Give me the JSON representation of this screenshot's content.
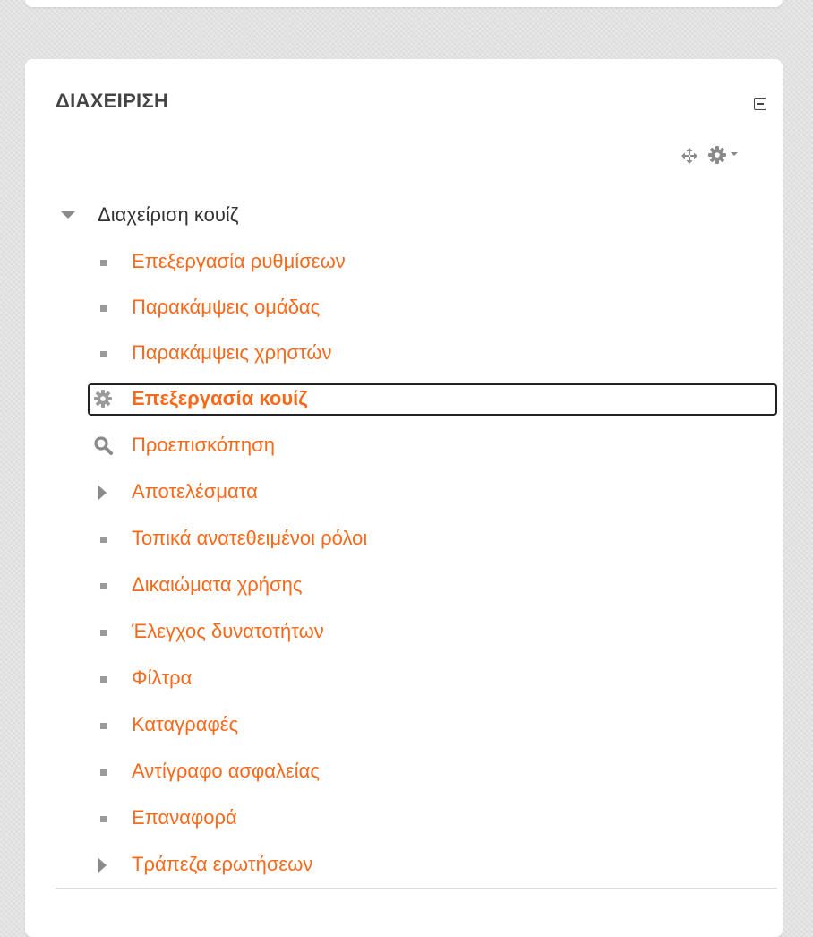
{
  "block": {
    "title": "ΔΙΑΧΕΙΡΙΣΗ",
    "icons": {
      "collapse": "collapse-icon",
      "move": "move-icon",
      "actions": "gear-icon"
    }
  },
  "colors": {
    "link": "#f7691b",
    "title": "#444444",
    "section": "#333333",
    "icon": "#9a9a9a"
  },
  "tree": {
    "section_label": "Διαχείριση κουίζ",
    "items": [
      {
        "label": "Επεξεργασία ρυθμίσεων",
        "icon": "bullet"
      },
      {
        "label": "Παρακάμψεις ομάδας",
        "icon": "bullet"
      },
      {
        "label": "Παρακάμψεις χρηστών",
        "icon": "bullet"
      },
      {
        "label": "Επεξεργασία κουίζ",
        "icon": "gear-icon",
        "active": true
      },
      {
        "label": "Προεπισκόπηση",
        "icon": "search-icon"
      },
      {
        "label": "Αποτελέσματα",
        "icon": "expand-arrow"
      },
      {
        "label": "Τοπικά ανατεθειμένοι ρόλοι",
        "icon": "bullet"
      },
      {
        "label": "Δικαιώματα χρήσης",
        "icon": "bullet"
      },
      {
        "label": "Έλεγχος δυνατοτήτων",
        "icon": "bullet"
      },
      {
        "label": "Φίλτρα",
        "icon": "bullet"
      },
      {
        "label": "Καταγραφές",
        "icon": "bullet"
      },
      {
        "label": "Αντίγραφο ασφαλείας",
        "icon": "bullet"
      },
      {
        "label": "Επαναφορά",
        "icon": "bullet"
      },
      {
        "label": "Τράπεζα ερωτήσεων",
        "icon": "expand-arrow"
      }
    ]
  }
}
